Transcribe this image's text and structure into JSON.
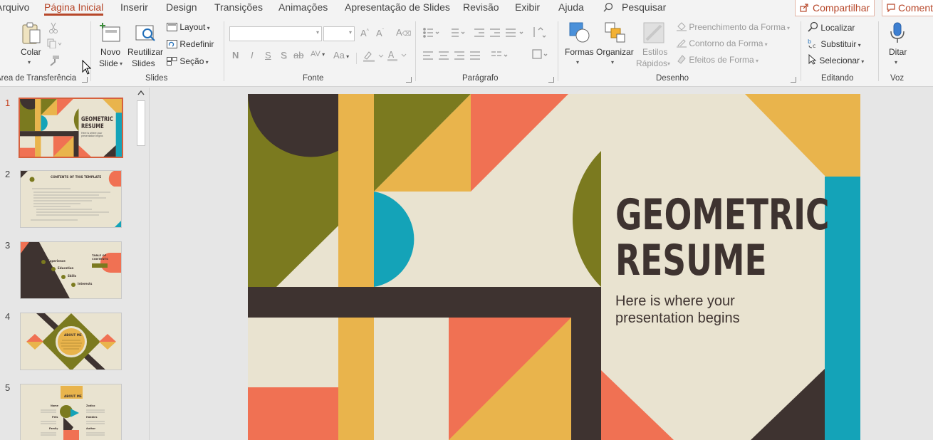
{
  "menu": {
    "tabs": [
      "Arquivo",
      "Página Inicial",
      "Inserir",
      "Design",
      "Transições",
      "Animações",
      "Apresentação de Slides",
      "Revisão",
      "Exibir",
      "Ajuda"
    ],
    "active_tab": "Página Inicial",
    "search_label": "Pesquisar",
    "share_label": "Compartilhar",
    "comments_label": "Comentários"
  },
  "ribbon": {
    "clipboard": {
      "paste": "Colar",
      "group": "Área de Transferência"
    },
    "slides": {
      "new_slide_1": "Novo",
      "new_slide_2": "Slide",
      "reuse_1": "Reutilizar",
      "reuse_2": "Slides",
      "layout": "Layout",
      "reset": "Redefinir",
      "section": "Seção",
      "group": "Slides"
    },
    "font": {
      "bold": "N",
      "italic": "I",
      "underline": "S",
      "shadow": "S",
      "strike": "ab",
      "spacing": "AV",
      "case": "Aa",
      "group": "Fonte"
    },
    "paragraph": {
      "group": "Parágrafo"
    },
    "drawing": {
      "shapes": "Formas",
      "arrange": "Organizar",
      "quick_1": "Estilos",
      "quick_2": "Rápidos",
      "fill": "Preenchimento da Forma",
      "outline": "Contorno da Forma",
      "effects": "Efeitos de Forma",
      "group": "Desenho"
    },
    "editing": {
      "find": "Localizar",
      "replace": "Substituir",
      "select": "Selecionar",
      "group": "Editando"
    },
    "voice": {
      "dictate": "Ditar",
      "group": "Voz"
    }
  },
  "thumbnails": {
    "numbers": [
      "1",
      "2",
      "3",
      "4",
      "5"
    ],
    "selected": "1",
    "t1_title_1": "GEOMETRIC",
    "t1_title_2": "RESUME",
    "t1_sub": "Here is where your presentation begins",
    "t2_title": "CONTENTS OF THIS TEMPLATE",
    "t3_title_1": "TABLE OF",
    "t3_title_2": "CONTENTS",
    "t3_items": [
      "Experience",
      "Education",
      "Skills",
      "Interests"
    ],
    "t4_title": "ABOUT ME",
    "t5_title": "ABOUT ME",
    "t5_items": [
      "Name",
      "Zodiac",
      "Pets",
      "Hobbies",
      "Family",
      "Author"
    ]
  },
  "slide": {
    "title_line1": "GEOMETRIC",
    "title_line2": "RESUME",
    "subtitle_line1": "Here is where your",
    "subtitle_line2": "presentation begins"
  },
  "colors": {
    "accent": "#b7472a",
    "olive": "#7b7a1f",
    "mustard": "#e9b44c",
    "coral": "#f07153",
    "teal": "#14a3b8",
    "dark": "#3e3330",
    "cream": "#e9e3d0"
  }
}
